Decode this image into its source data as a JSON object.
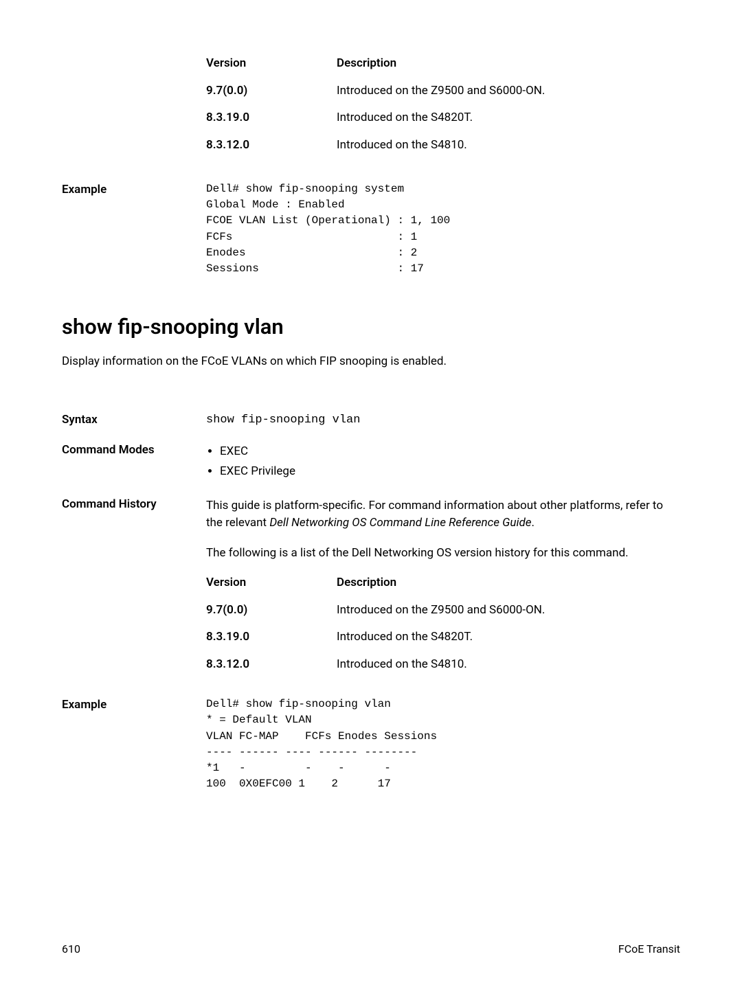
{
  "section1": {
    "versions_header": {
      "version": "Version",
      "description": "Description"
    },
    "versions": [
      {
        "v": "9.7(0.0)",
        "d": "Introduced on the Z9500 and S6000-ON."
      },
      {
        "v": "8.3.19.0",
        "d": "Introduced on the S4820T."
      },
      {
        "v": "8.3.12.0",
        "d": "Introduced on the S4810."
      }
    ],
    "example_label": "Example",
    "example_code": "Dell# show fip-snooping system\nGlobal Mode : Enabled\nFCOE VLAN List (Operational) : 1, 100\nFCFs                         : 1\nEnodes                       : 2\nSessions                     : 17"
  },
  "section2": {
    "heading": "show fip-snooping vlan",
    "intro": "Display information on the FCoE VLANs on which FIP snooping is enabled.",
    "syntax_label": "Syntax",
    "syntax_cmd": "show fip-snooping vlan",
    "cmd_modes_label": "Command Modes",
    "cmd_modes": [
      "EXEC",
      "EXEC Privilege"
    ],
    "history_label": "Command History",
    "history_para1_pre": "This guide is platform-specific. For command information about other platforms, refer to the relevant ",
    "history_para1_italic": "Dell Networking OS Command Line Reference Guide",
    "history_para1_post": ".",
    "history_para2": "The following is a list of the Dell Networking OS version history for this command.",
    "versions_header": {
      "version": "Version",
      "description": "Description"
    },
    "versions": [
      {
        "v": "9.7(0.0)",
        "d": "Introduced on the Z9500 and S6000-ON."
      },
      {
        "v": "8.3.19.0",
        "d": "Introduced on the S4820T."
      },
      {
        "v": "8.3.12.0",
        "d": "Introduced on the S4810."
      }
    ],
    "example_label": "Example",
    "example_code": "Dell# show fip-snooping vlan\n* = Default VLAN\nVLAN FC-MAP    FCFs Enodes Sessions\n---- ------ ---- ------ --------\n*1   -         -    -      -\n100  0X0EFC00 1    2      17"
  },
  "footer": {
    "page": "610",
    "title": "FCoE Transit"
  }
}
